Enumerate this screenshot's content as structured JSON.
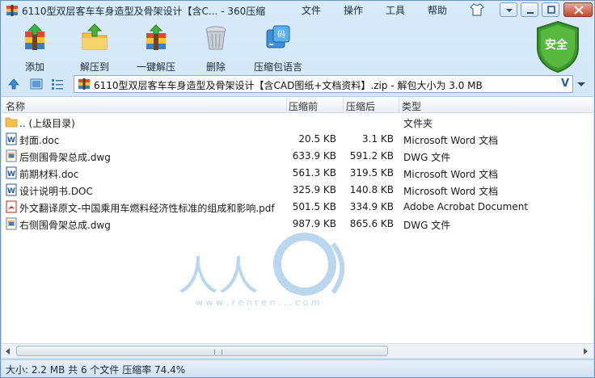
{
  "window": {
    "title": "6110型双层客车车身造型及骨架设计【含C... - 360压缩"
  },
  "menu": {
    "file": "文件",
    "operation": "操作",
    "tools": "工具",
    "help": "帮助"
  },
  "toolbar": {
    "add": "添加",
    "extract_to": "解压到",
    "one_click_extract": "一键解压",
    "delete": "删除",
    "archive_language": "压缩包语言"
  },
  "badge": {
    "security": "安全"
  },
  "address": {
    "path": "6110型双层客车车身造型及骨架设计【含CAD图纸+文档资料】.zip - 解包大小为 3.0 MB",
    "v_label": "V"
  },
  "columns": {
    "name": "名称",
    "size": "压缩前",
    "packed": "压缩后",
    "type": "类型"
  },
  "files": [
    {
      "name": ".. (上级目录)",
      "size": "",
      "packed": "",
      "type": "文件夹",
      "icon": "folder-icon"
    },
    {
      "name": "封面.doc",
      "size": "20.5 KB",
      "packed": "3.1 KB",
      "type": "Microsoft Word 文档",
      "icon": "word-doc-icon"
    },
    {
      "name": "后侧围骨架总成.dwg",
      "size": "633.9 KB",
      "packed": "591.2 KB",
      "type": "DWG 文件",
      "icon": "dwg-file-icon"
    },
    {
      "name": "前期材料.doc",
      "size": "561.3 KB",
      "packed": "319.5 KB",
      "type": "Microsoft Word 文档",
      "icon": "word-doc-icon"
    },
    {
      "name": "设计说明书.DOC",
      "size": "325.9 KB",
      "packed": "140.8 KB",
      "type": "Microsoft Word 文档",
      "icon": "word-doc-icon"
    },
    {
      "name": "外文翻译原文-中国乘用车燃料经济性标准的组成和影响.pdf",
      "size": "501.5 KB",
      "packed": "334.9 KB",
      "type": "Adobe Acrobat Document",
      "icon": "pdf-file-icon"
    },
    {
      "name": "右侧围骨架总成.dwg",
      "size": "987.9 KB",
      "packed": "865.6 KB",
      "type": "DWG 文件",
      "icon": "dwg-file-icon"
    }
  ],
  "status": {
    "text": "大小: 2.2 MB 共 6 个文件 压缩率 74.4%"
  },
  "watermark": {
    "text": "人人",
    "url_text": "w w w . r e n r e n . . . c o m"
  }
}
